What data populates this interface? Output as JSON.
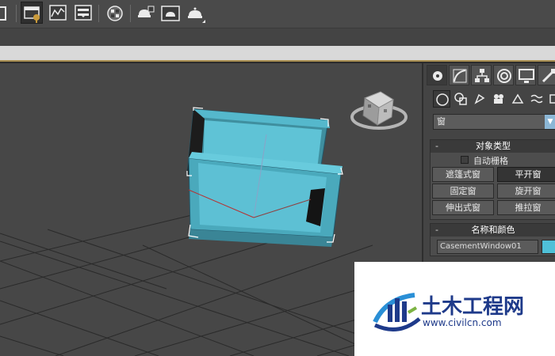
{
  "toolbar": {
    "icons": [
      "layer-explorer-icon",
      "scene-explorer-icon",
      "curve-editor-icon",
      "schematic-view-icon",
      "material-editor-icon",
      "render-setup-icon",
      "rendered-frame-icon",
      "render-production-icon"
    ]
  },
  "command_panel": {
    "tabs": [
      "create-tab",
      "modify-tab",
      "hierarchy-tab",
      "motion-tab",
      "display-tab",
      "utilities-tab"
    ],
    "subcategories": [
      "geometry-icon",
      "shapes-icon",
      "lights-icon",
      "cameras-icon",
      "helpers-icon",
      "space-warps-icon"
    ],
    "category_value": "窗",
    "object_type": {
      "title": "对象类型",
      "autogrid_label": "自动栅格",
      "buttons": [
        "遮篷式窗",
        "平开窗",
        "固定窗",
        "旋开窗",
        "伸出式窗",
        "推拉窗"
      ],
      "selected": "平开窗"
    },
    "name_and_color": {
      "title": "名称和颜色",
      "name_value": "CasementWindow01",
      "color": "#4fc0d8"
    },
    "rollout_toggle": "-"
  },
  "viewport": {
    "object_color": "#55b8cc",
    "grid_color": "#2a2a2a"
  },
  "watermark": {
    "title": "土木工程网",
    "url": "www.civilcn.com"
  },
  "colors": {
    "accent": "#a88d50",
    "selection": "#4fc0d8"
  }
}
